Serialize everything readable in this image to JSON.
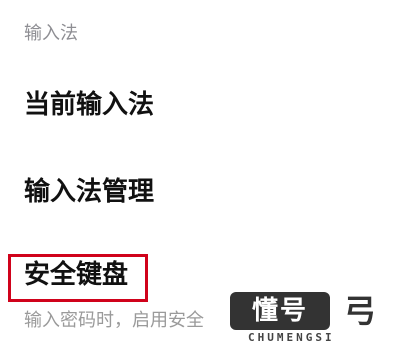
{
  "section": {
    "header": "输入法"
  },
  "items": [
    {
      "label": "当前输入法"
    },
    {
      "label": "输入法管理"
    },
    {
      "label": "安全键盘",
      "description": "输入密码时，启用安全"
    }
  ],
  "highlight_color": "#d0021b",
  "watermark": {
    "logo_text": "懂号",
    "symbol": "弓",
    "caption": "CHUMENGSI"
  }
}
